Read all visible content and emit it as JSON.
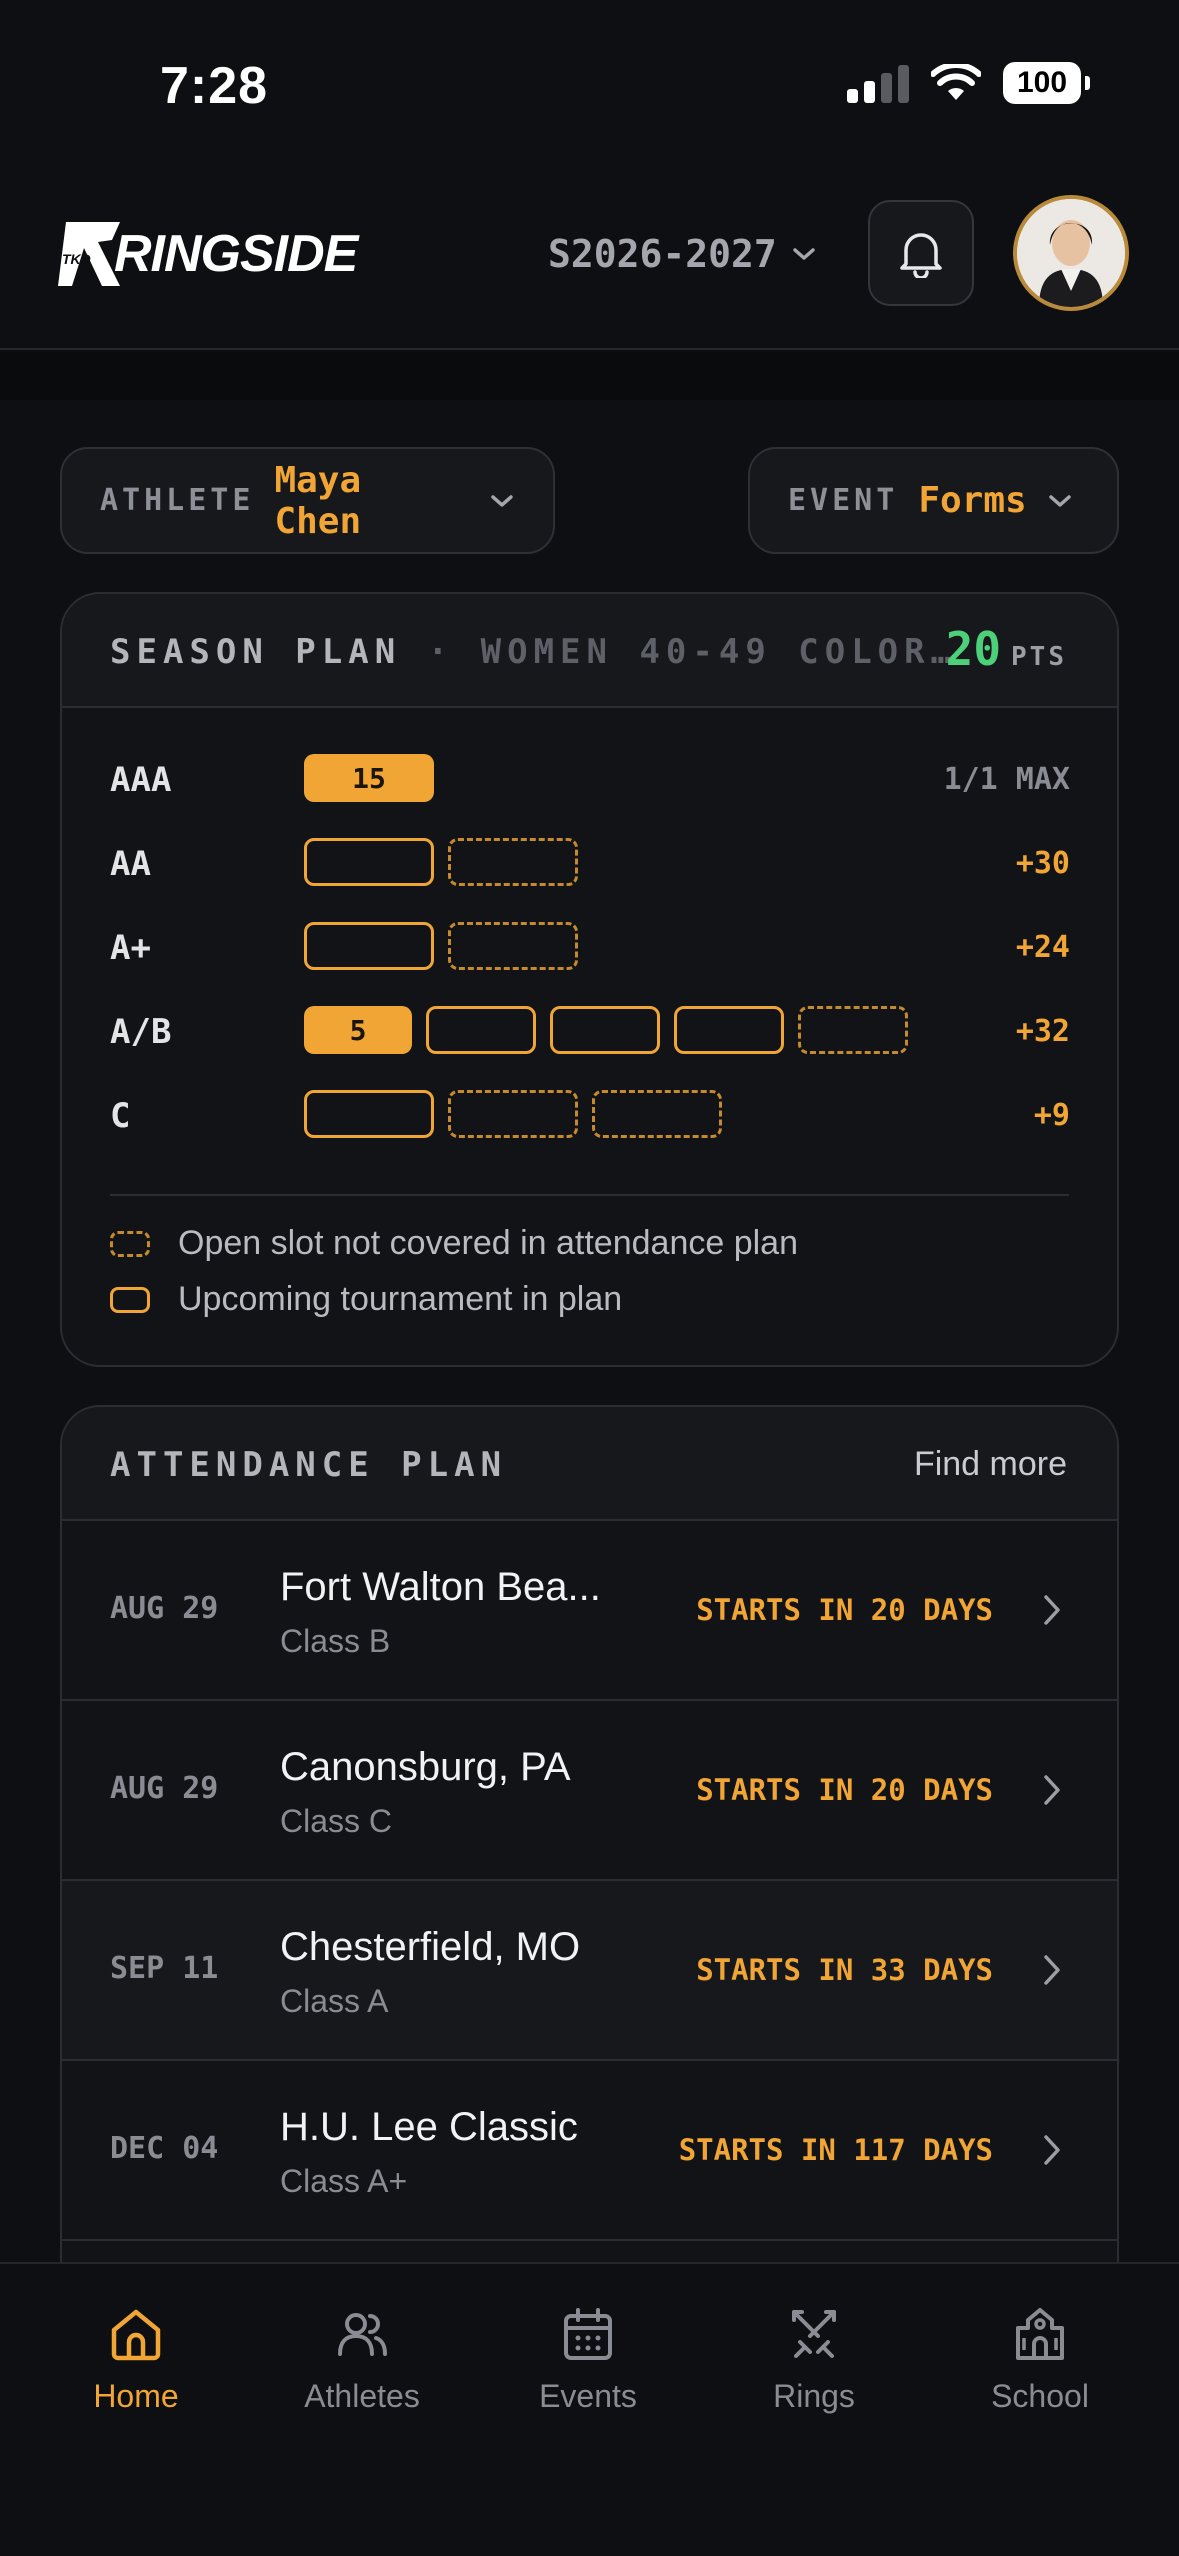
{
  "status_bar": {
    "time": "7:28",
    "battery": "100"
  },
  "header": {
    "logo_text": "RINGSIDE",
    "logo_badge": "TKD",
    "season": "S2026-2027"
  },
  "filters": {
    "athlete_label": "ATHLETE",
    "athlete_value": "Maya Chen",
    "event_label": "EVENT",
    "event_value": "Forms"
  },
  "season_plan": {
    "title": "SEASON PLAN",
    "separator": "·",
    "division": "WOMEN 40-49 COLOR…",
    "points": "20",
    "points_unit": "PTS",
    "tiers": [
      {
        "label": "AAA",
        "right": "1/1 MAX"
      },
      {
        "label": "AA",
        "right": "+30"
      },
      {
        "label": "A+",
        "right": "+24"
      },
      {
        "label": "A/B",
        "right": "+32"
      },
      {
        "label": "C",
        "right": "+9"
      }
    ],
    "slot_values": {
      "aaa": "15",
      "ab": "5"
    },
    "legend": [
      {
        "text": "Open slot not covered in attendance plan"
      },
      {
        "text": "Upcoming tournament in plan"
      }
    ]
  },
  "attendance_plan": {
    "title": "ATTENDANCE PLAN",
    "find_more": "Find more",
    "events": [
      {
        "date": "AUG 29",
        "name": "Fort Walton Bea...",
        "class": "Class B",
        "status": "STARTS IN 20 DAYS"
      },
      {
        "date": "AUG 29",
        "name": "Canonsburg, PA",
        "class": "Class C",
        "status": "STARTS IN 20 DAYS"
      },
      {
        "date": "SEP 11",
        "name": "Chesterfield, MO",
        "class": "Class A",
        "status": "STARTS IN 33 DAYS"
      },
      {
        "date": "DEC 04",
        "name": "H.U. Lee Classic",
        "class": "Class A+",
        "status": "STARTS IN 117 DAYS"
      }
    ]
  },
  "nav": {
    "items": [
      {
        "label": "Home",
        "icon": "home-icon"
      },
      {
        "label": "Athletes",
        "icon": "users-icon"
      },
      {
        "label": "Events",
        "icon": "calendar-icon"
      },
      {
        "label": "Rings",
        "icon": "swords-icon"
      },
      {
        "label": "School",
        "icon": "school-icon"
      }
    ]
  },
  "colors": {
    "accent": "#f0a535",
    "points": "#4cd17a",
    "background": "#0e0f12"
  }
}
